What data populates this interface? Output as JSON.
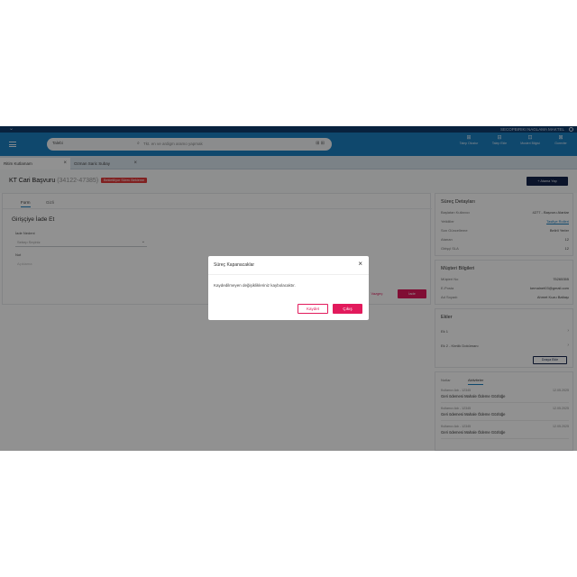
{
  "topstrip": {
    "user": "SECOPBIRIKI NAGLAMA MAKTEL"
  },
  "header": {
    "search_prefix": "Talebi",
    "search_placeholder": "Tkt. en ve ardigm aramo yapmak",
    "search_right": "⊞ ⊞",
    "icons": [
      {
        "name": "request-icon",
        "glyph": "⊞",
        "label": "Talep Olustur"
      },
      {
        "name": "ticket-icon",
        "glyph": "⊟",
        "label": "Talep Ekle"
      },
      {
        "name": "customer-icon",
        "glyph": "⊡",
        "label": "Musteri Bilgisi"
      },
      {
        "name": "task-icon",
        "glyph": "⊠",
        "label": "Gorevler"
      }
    ]
  },
  "tabs": [
    {
      "label": "Ritim Kutlamam"
    },
    {
      "label": "Ozman Saric Subay"
    }
  ],
  "page": {
    "title": "KT Cari Başvuru",
    "title_sub": "(34122-47385)",
    "badge": "Bekletiliyor Sürec Bekleme",
    "top_button": "+ Atama Yap"
  },
  "left": {
    "subtabs": [
      "Form",
      "Gizli"
    ],
    "heading": "Girişçiye İade Et",
    "field1_label": "İade Nedeni",
    "field1_value": "Sebep Seçiniz",
    "field2_label": "Not",
    "field2_value": "Açıklama",
    "cancel": "Vazgeç",
    "save": "İade"
  },
  "process": {
    "title": "Süreç Detayları",
    "rows": [
      {
        "k": "Başlatan Kullanıcı",
        "v": "4277 - Başvuru Alanlar",
        "link": false
      },
      {
        "k": "Yetkililer",
        "v": "Tasfiye Rolleri",
        "link": true
      },
      {
        "k": "Son Güncelleme",
        "v": "Belirli Yerler",
        "link": false
      },
      {
        "k": "Atanan",
        "v": "12",
        "link": false
      },
      {
        "k": "Girişçi SLA",
        "v": "12",
        "link": false
      }
    ]
  },
  "customer": {
    "title": "Müşteri Bilgileri",
    "rows": [
      {
        "k": "Müşteri No",
        "v": "75265355",
        "link": false
      },
      {
        "k": "E-Posta",
        "v": "kemalnet03@gmail.com",
        "link": false
      },
      {
        "k": "Ad Soyadı",
        "v": "Ahmet Kuzu Baltaşı",
        "link": false
      }
    ]
  },
  "files": {
    "title": "Ekler",
    "rows": [
      "Ek 1",
      "Ek 2 - Kimlik Dokümanı"
    ],
    "button": "Dosya Ekle"
  },
  "activity": {
    "tabs": [
      "Notlar",
      "Aktiviteler"
    ],
    "items": [
      {
        "who": "Kullanıcı Adı - 12345",
        "date": "12.05.2025",
        "text": "Geri ödemesi Mahale Ödeme Gözlüğe"
      },
      {
        "who": "Kullanıcı Adı - 12345",
        "date": "12.05.2025",
        "text": "Geri ödemesi Mahale Ödeme Gözlüğe"
      },
      {
        "who": "Kullanıcı Adı - 12345",
        "date": "12.05.2025",
        "text": "Geri ödemesi Mahale Ödeme Gözlüğe"
      }
    ]
  },
  "modal": {
    "title": "Süreç Kapanacaklar",
    "text": "Kaydedilmeyen değişiklikleriniz kaybolacaktır.",
    "save": "Kaydet",
    "exit": "Çıkış"
  },
  "colors": {
    "accent": "#e21a5c",
    "header": "#1c7fc0",
    "navy": "#14244a"
  }
}
